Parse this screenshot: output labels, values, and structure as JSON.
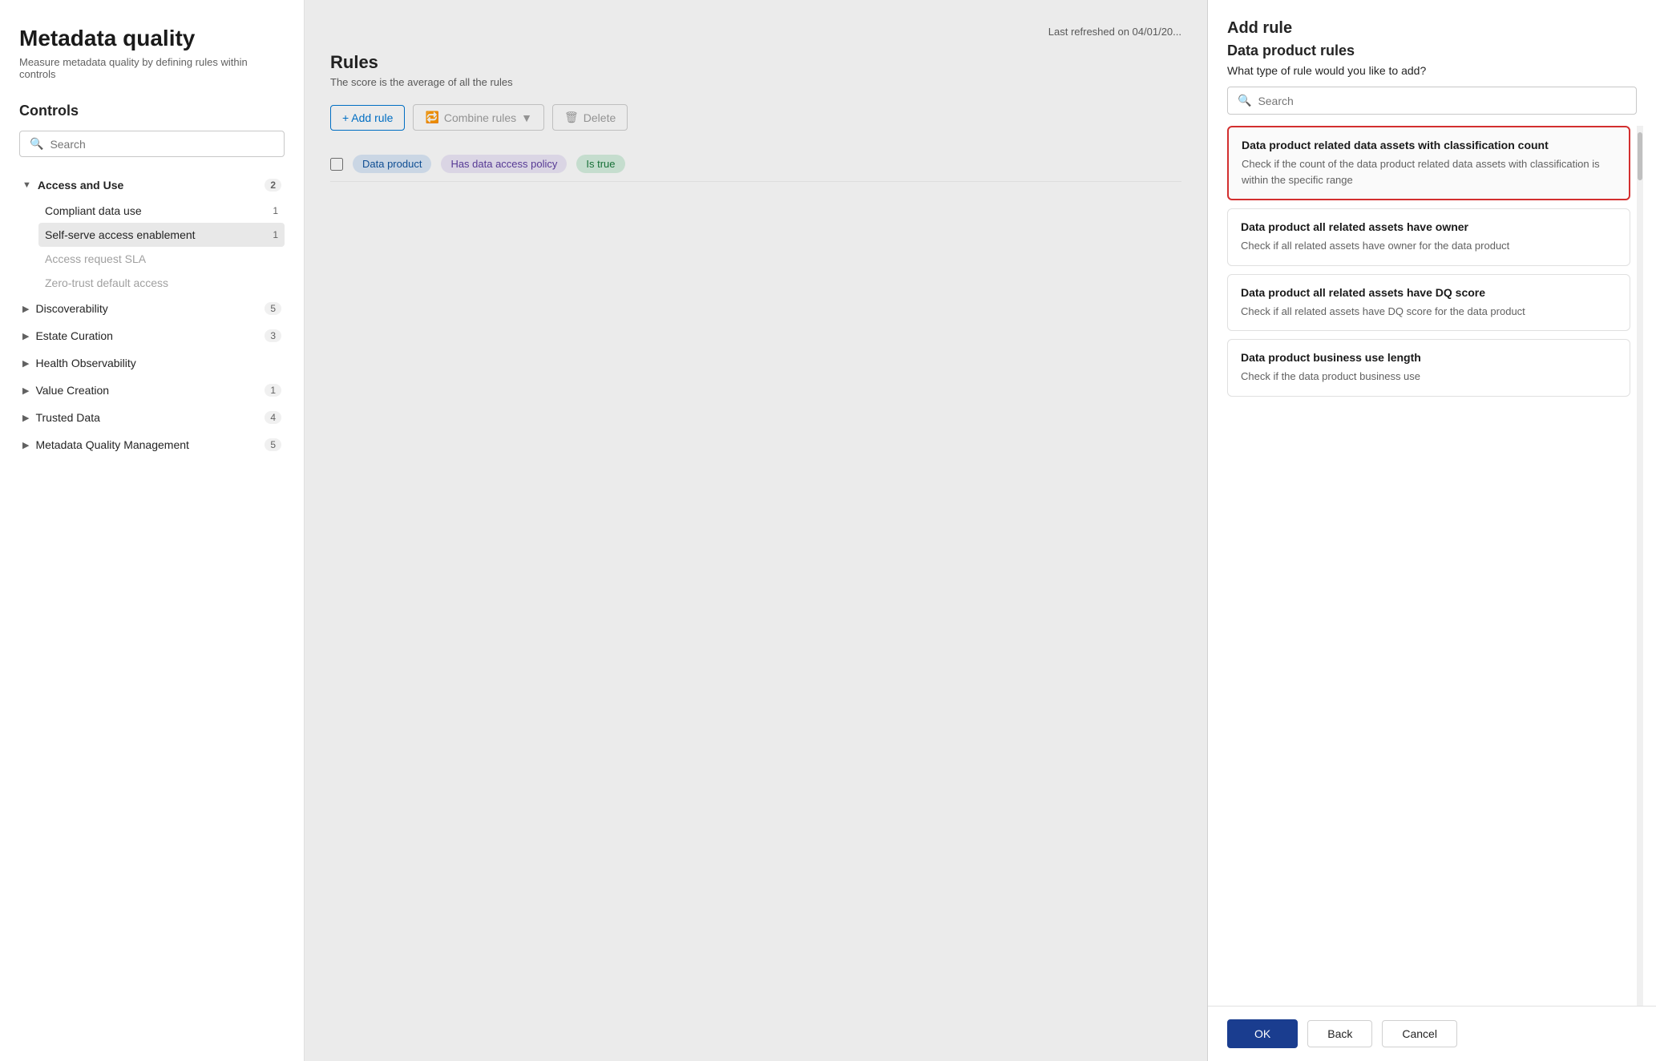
{
  "page": {
    "title": "Metadata quality",
    "subtitle": "Measure metadata quality by defining rules within controls",
    "last_refreshed": "Last refreshed on 04/01/20..."
  },
  "controls": {
    "heading": "Controls",
    "search_placeholder": "Search",
    "nav_items": [
      {
        "label": "Access and Use",
        "count": "2",
        "expanded": true,
        "sub_items": [
          {
            "label": "Compliant data use",
            "count": "1",
            "active": false,
            "disabled": false
          },
          {
            "label": "Self-serve access enablement",
            "count": "1",
            "active": true,
            "disabled": false
          },
          {
            "label": "Access request SLA",
            "count": "",
            "active": false,
            "disabled": true
          },
          {
            "label": "Zero-trust default access",
            "count": "",
            "active": false,
            "disabled": true
          }
        ]
      },
      {
        "label": "Discoverability",
        "count": "5",
        "expanded": false
      },
      {
        "label": "Estate Curation",
        "count": "3",
        "expanded": false
      },
      {
        "label": "Health Observability",
        "count": "",
        "expanded": false
      },
      {
        "label": "Value Creation",
        "count": "1",
        "expanded": false
      },
      {
        "label": "Trusted Data",
        "count": "4",
        "expanded": false
      },
      {
        "label": "Metadata Quality Management",
        "count": "5",
        "expanded": false
      }
    ]
  },
  "rules_section": {
    "heading": "Rules",
    "subtext": "The score is the average of all the rules",
    "toolbar": {
      "add_rule": "+ Add rule",
      "combine_rules": "Combine rules",
      "delete": "Delete"
    },
    "rules": [
      {
        "tag1": "Data product",
        "tag2": "Has data access policy",
        "tag3": "Is true"
      }
    ]
  },
  "add_rule_panel": {
    "title": "Add rule",
    "dp_rules_title": "Data product rules",
    "rule_type_label": "What type of rule would you like to add?",
    "search_placeholder": "Search",
    "rule_cards": [
      {
        "id": "card1",
        "title": "Data product related data assets with classification count",
        "description": "Check if the count of the data product related data assets with classification is within the specific range",
        "selected": true
      },
      {
        "id": "card2",
        "title": "Data product all related assets have owner",
        "description": "Check if all related assets have owner for the data product",
        "selected": false
      },
      {
        "id": "card3",
        "title": "Data product all related assets have DQ score",
        "description": "Check if all related assets have DQ score for the data product",
        "selected": false
      },
      {
        "id": "card4",
        "title": "Data product business use length",
        "description": "Check if the data product business use",
        "selected": false
      }
    ],
    "buttons": {
      "ok": "OK",
      "back": "Back",
      "cancel": "Cancel"
    }
  }
}
